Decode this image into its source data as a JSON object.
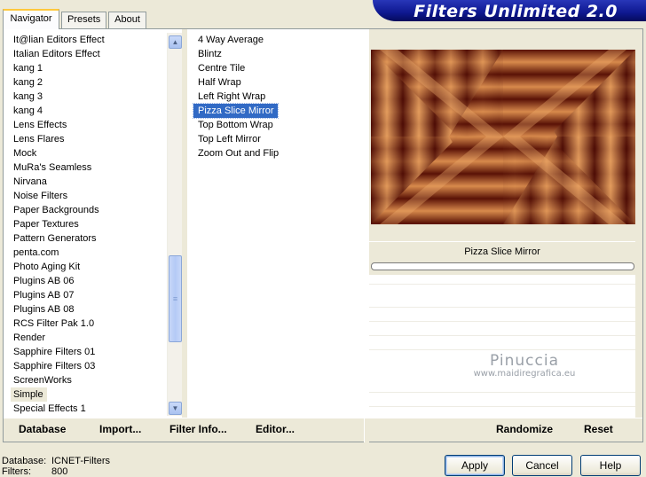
{
  "tabs": [
    {
      "label": "Navigator",
      "active": true
    },
    {
      "label": "Presets",
      "active": false
    },
    {
      "label": "About",
      "active": false
    }
  ],
  "banner_title": "Filters Unlimited 2.0",
  "categories": [
    "It@lian Editors Effect",
    "Italian Editors Effect",
    "kang 1",
    "kang 2",
    "kang 3",
    "kang 4",
    "Lens Effects",
    "Lens Flares",
    "Mock",
    "MuRa's Seamless",
    "Nirvana",
    "Noise Filters",
    "Paper Backgrounds",
    "Paper Textures",
    "Pattern Generators",
    "penta.com",
    "Photo Aging Kit",
    "Plugins AB 06",
    "Plugins AB 07",
    "Plugins AB 08",
    "RCS Filter Pak 1.0",
    "Render",
    "Sapphire Filters 01",
    "Sapphire Filters 03",
    "ScreenWorks",
    "Simple",
    "Special Effects 1"
  ],
  "selected_category": "Simple",
  "filters": [
    "4 Way Average",
    "Blintz",
    "Centre Tile",
    "Half Wrap",
    "Left Right Wrap",
    "Pizza Slice Mirror",
    "Top Bottom Wrap",
    "Top Left Mirror",
    "Zoom Out and Flip"
  ],
  "selected_filter": "Pizza Slice Mirror",
  "preview": {
    "filter_name": "Pizza Slice Mirror",
    "watermark_name": "Pinuccia",
    "watermark_url": "www.maidiregrafica.eu"
  },
  "toolbar": {
    "database": "Database",
    "import": "Import...",
    "filter_info": "Filter Info...",
    "editor": "Editor...",
    "randomize": "Randomize",
    "reset": "Reset"
  },
  "status": {
    "database_label": "Database:",
    "database_value": "ICNET-Filters",
    "filters_label": "Filters:",
    "filters_value": "800"
  },
  "buttons": {
    "apply": "Apply",
    "cancel": "Cancel",
    "help": "Help"
  },
  "colors": {
    "selection": "#316ac5",
    "banner": "#0e1890",
    "face": "#ece9d8"
  }
}
